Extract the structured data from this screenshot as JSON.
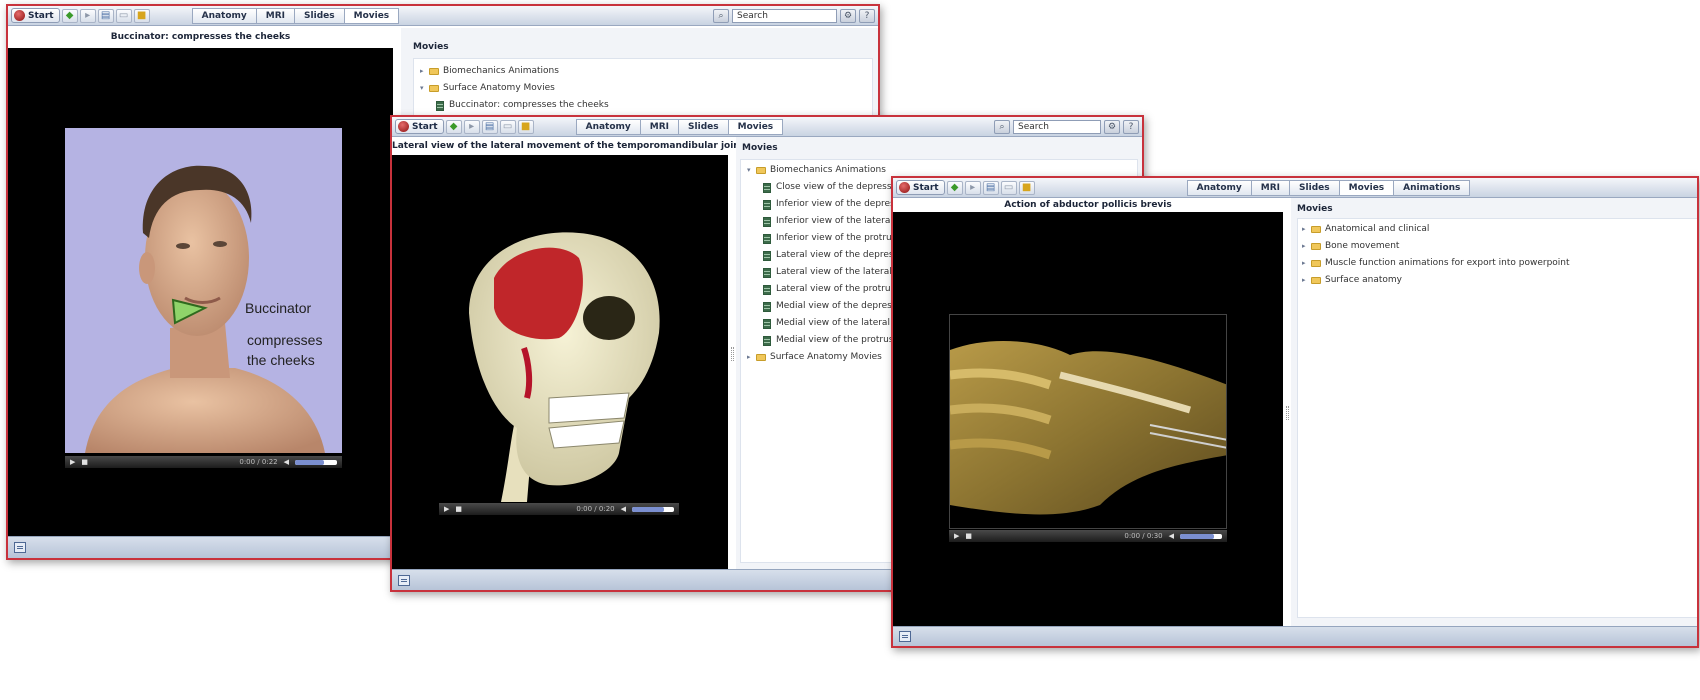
{
  "app": {
    "start_label": "Start",
    "search_placeholder": "Search"
  },
  "window1": {
    "tabs": [
      "Anatomy",
      "MRI",
      "Slides",
      "Movies"
    ],
    "video_title": "Buccinator: compresses the cheeks",
    "video_text_line1": "Buccinator",
    "video_text_line2": "compresses",
    "video_text_line3": "the cheeks",
    "time": "0:00 / 0:22",
    "volume_level": 0.7,
    "panel_title": "Movies",
    "tree": [
      {
        "label": "Biomechanics Animations",
        "type": "folder",
        "expanded": false
      },
      {
        "label": "Surface Anatomy Movies",
        "type": "folder",
        "expanded": true
      },
      {
        "label": "Buccinator: compresses the cheeks",
        "type": "movie"
      }
    ]
  },
  "window2": {
    "tabs": [
      "Anatomy",
      "MRI",
      "Slides",
      "Movies"
    ],
    "video_title": "Lateral view of the lateral movement of the temporomandibular joint",
    "time": "0:00 / 0:20",
    "volume_level": 0.75,
    "panel_title": "Movies",
    "tree": [
      {
        "label": "Biomechanics Animations",
        "type": "folder",
        "expanded": true
      },
      {
        "label": "Close view of the depression and elevation",
        "type": "movie"
      },
      {
        "label": "Inferior view of the depression and elevation",
        "type": "movie"
      },
      {
        "label": "Inferior view of the lateral movement",
        "type": "movie"
      },
      {
        "label": "Inferior view of the protrusion and retrusion",
        "type": "movie"
      },
      {
        "label": "Lateral view of the depression and elevation",
        "type": "movie"
      },
      {
        "label": "Lateral view of the lateral movement",
        "type": "movie"
      },
      {
        "label": "Lateral view of the protrusion and retrusion",
        "type": "movie"
      },
      {
        "label": "Medial view of the depression and elevation",
        "type": "movie"
      },
      {
        "label": "Medial view of the lateral movement",
        "type": "movie"
      },
      {
        "label": "Medial view of the protrusion and retrusion",
        "type": "movie"
      },
      {
        "label": "Surface Anatomy Movies",
        "type": "folder",
        "expanded": false
      }
    ]
  },
  "window3": {
    "tabs": [
      "Anatomy",
      "MRI",
      "Slides",
      "Movies",
      "Animations"
    ],
    "video_title": "Action of abductor pollicis brevis",
    "time": "0:00 / 0:30",
    "volume_level": 0.8,
    "panel_title": "Movies",
    "tree": [
      {
        "label": "Anatomical and clinical",
        "type": "folder",
        "expanded": false
      },
      {
        "label": "Bone movement",
        "type": "folder",
        "expanded": false
      },
      {
        "label": "Muscle function animations for export into powerpoint",
        "type": "folder",
        "expanded": false
      },
      {
        "label": "Surface anatomy",
        "type": "folder",
        "expanded": false
      }
    ]
  }
}
